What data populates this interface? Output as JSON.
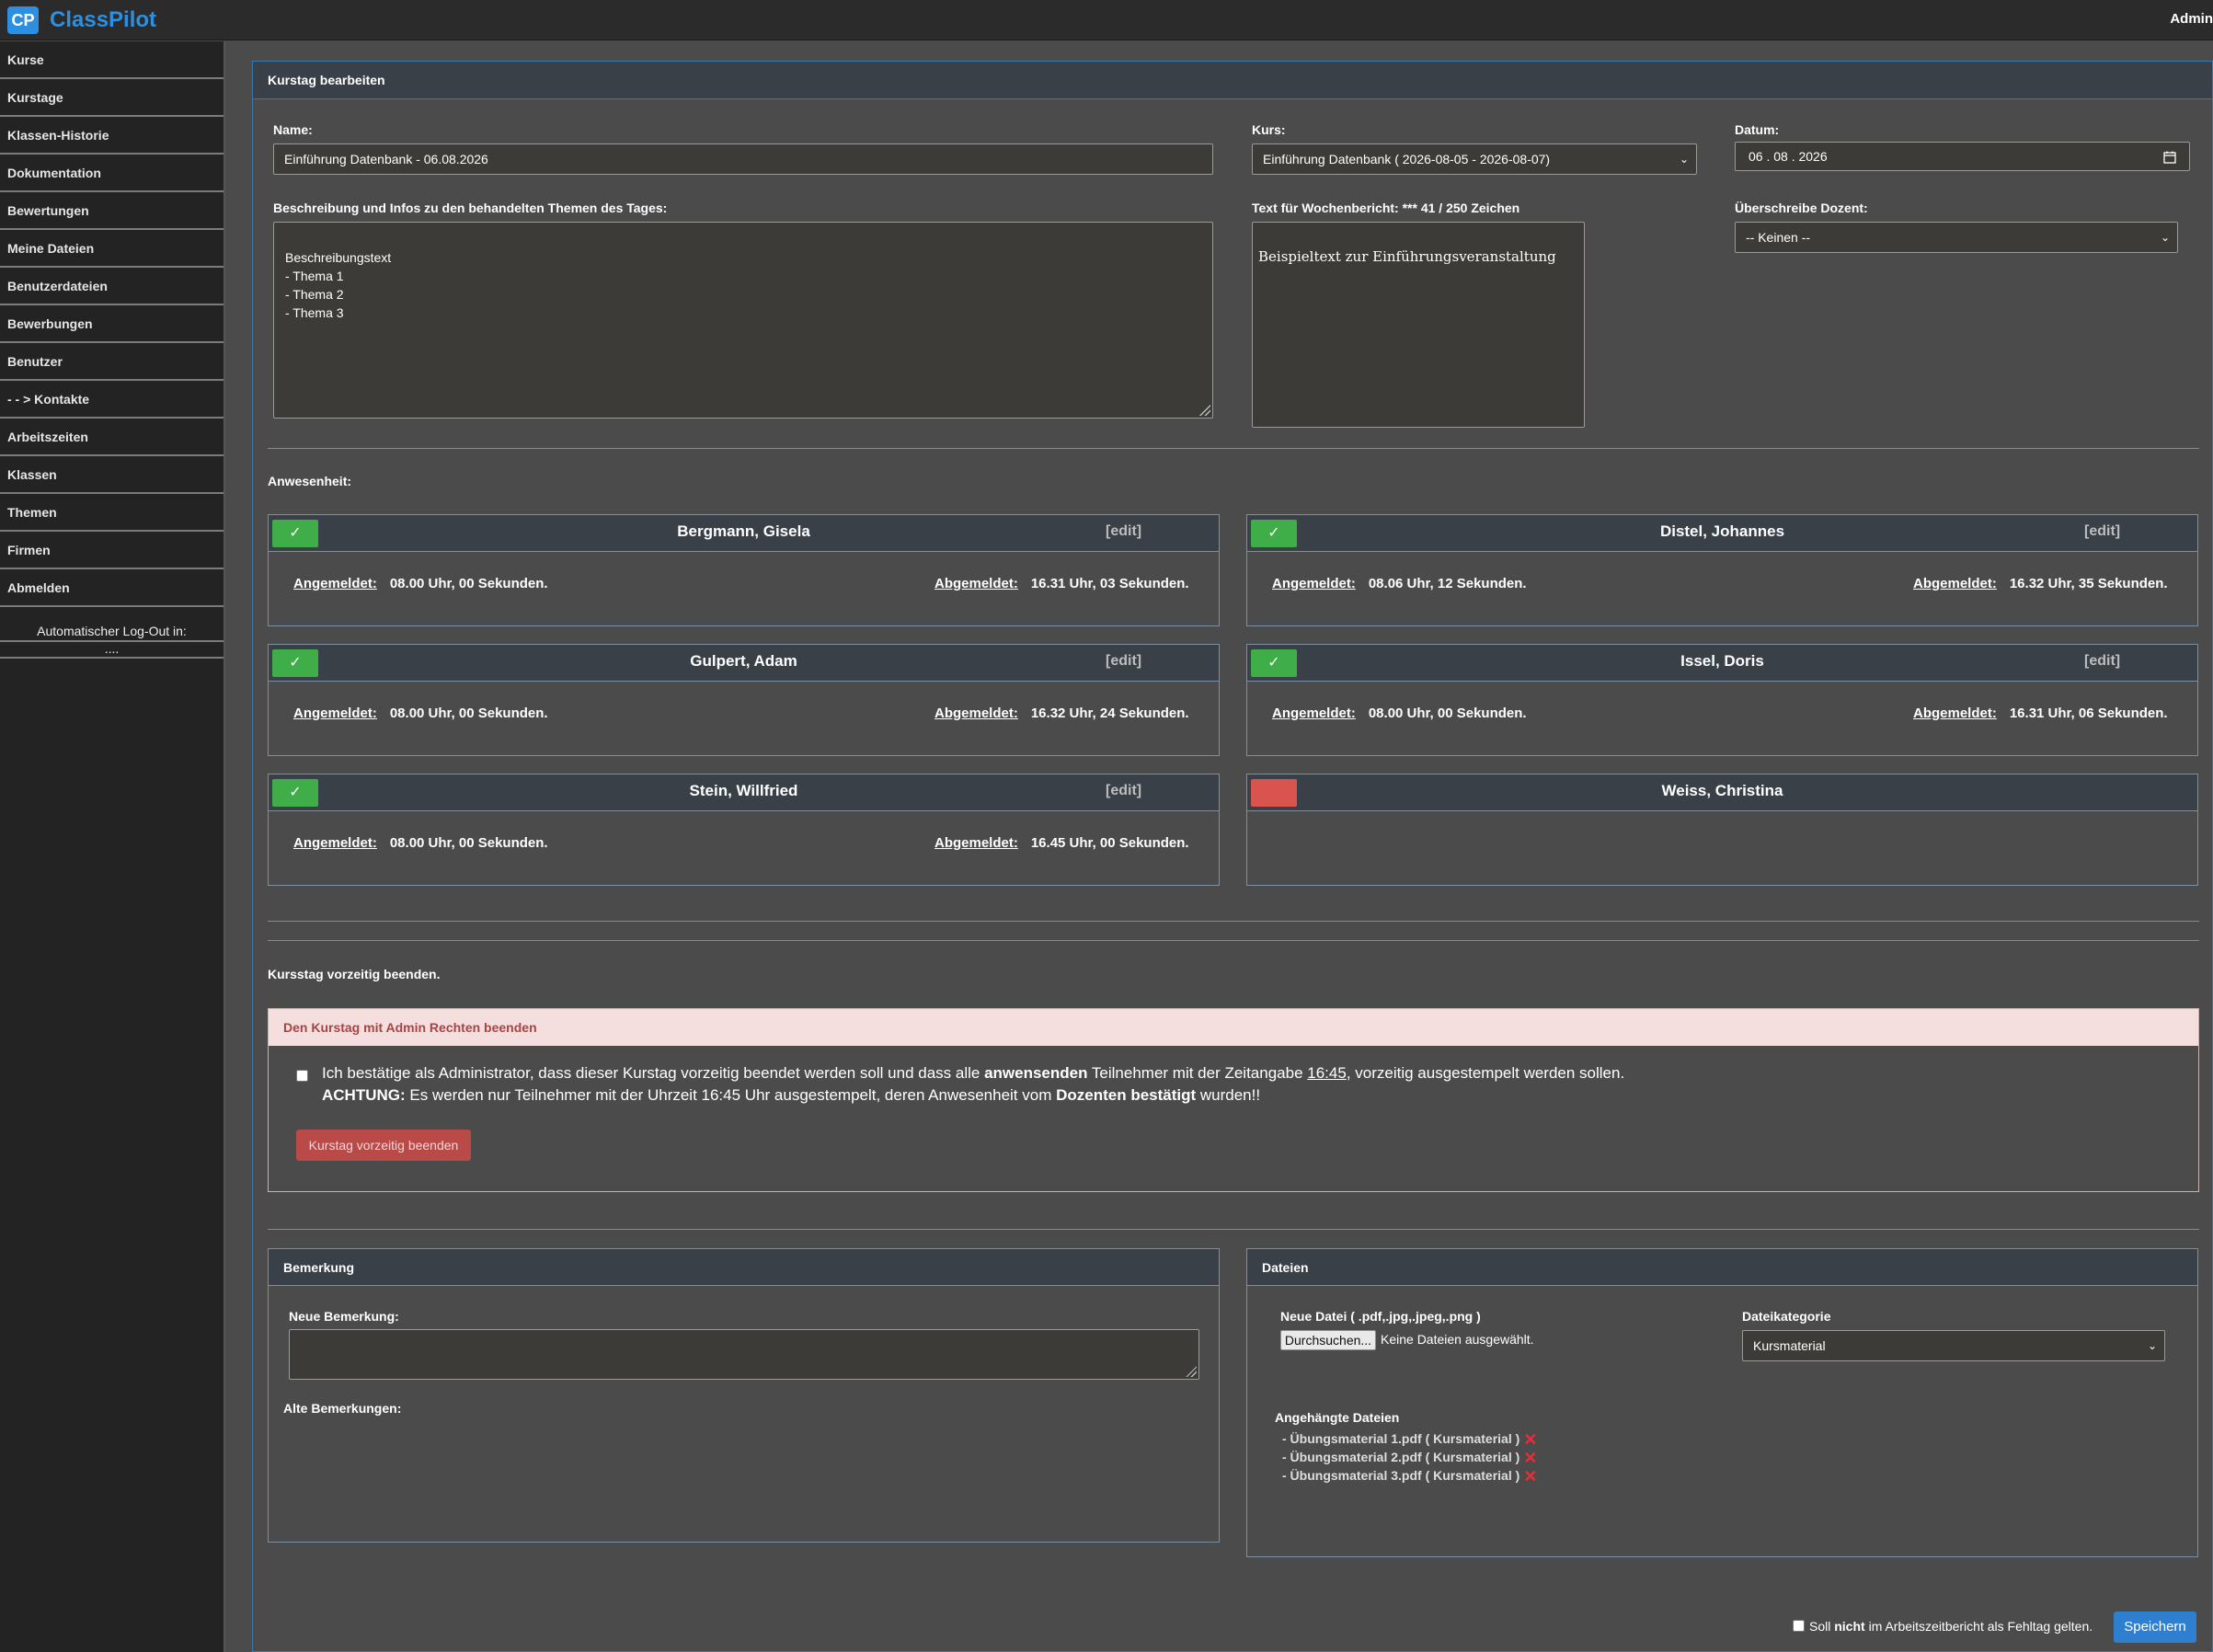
{
  "app": {
    "logo_badge": "CP",
    "name": "ClassPilot",
    "user": "Admin"
  },
  "sidebar": {
    "items": [
      {
        "label": "Kurse"
      },
      {
        "label": "Kurstage"
      },
      {
        "label": "Klassen-Historie"
      },
      {
        "label": "Dokumentation"
      },
      {
        "label": "Bewertungen"
      },
      {
        "label": "Meine Dateien"
      },
      {
        "label": "Benutzerdateien"
      },
      {
        "label": "Bewerbungen"
      },
      {
        "label": "Benutzer"
      },
      {
        "label": "- - > Kontakte"
      },
      {
        "label": "Arbeitszeiten"
      },
      {
        "label": "Klassen"
      },
      {
        "label": "Themen"
      },
      {
        "label": "Firmen"
      },
      {
        "label": "Abmelden"
      }
    ],
    "logout_label": "Automatischer Log-Out in:",
    "logout_value": "...."
  },
  "panel": {
    "title": "Kurstag bearbeiten"
  },
  "form": {
    "name_label": "Name:",
    "name_value": "Einführung Datenbank - 06.08.2026",
    "kurs_label": "Kurs:",
    "kurs_value": "Einführung Datenbank ( 2026-08-05 - 2026-08-07)",
    "datum_label": "Datum:",
    "datum_value": "06 . 08 . 2026",
    "beschreibung_label": "Beschreibung und Infos zu den behandelten Themen des Tages:",
    "beschreibung_value": "Beschreibungstext\n- Thema 1\n- Thema 2\n- Thema 3",
    "wochenbericht_label": "Text für Wochenbericht: ***   41 / 250 Zeichen",
    "wochenbericht_value": "Beispieltext zur Einführungsveranstaltung",
    "dozent_label": "Überschreibe Dozent:",
    "dozent_value": "-- Keinen --"
  },
  "attendance": {
    "label": "Anwesenheit:",
    "edit_label": "[edit]",
    "in_label": "Angemeldet:",
    "out_label": "Abgemeldet:",
    "ok_symbol": "✓",
    "people": [
      {
        "name": "Bergmann, Gisela",
        "status": "present",
        "in": "08.00 Uhr, 00 Sekunden.",
        "out": "16.31 Uhr, 03 Sekunden."
      },
      {
        "name": "Distel, Johannes",
        "status": "present",
        "in": "08.06 Uhr, 12 Sekunden.",
        "out": "16.32 Uhr, 35 Sekunden."
      },
      {
        "name": "Gulpert, Adam",
        "status": "present",
        "in": "08.00 Uhr, 00 Sekunden.",
        "out": "16.32 Uhr, 24 Sekunden."
      },
      {
        "name": "Issel, Doris",
        "status": "present",
        "in": "08.00 Uhr, 00 Sekunden.",
        "out": "16.31 Uhr, 06 Sekunden."
      },
      {
        "name": "Stein, Willfried",
        "status": "present",
        "in": "08.00 Uhr, 00 Sekunden.",
        "out": "16.45 Uhr, 00 Sekunden."
      },
      {
        "name": "Weiss, Christina",
        "status": "absent"
      }
    ]
  },
  "early_finish": {
    "section_label": "Kursstag vorzeitig beenden.",
    "box_title": "Den Kurstag mit Admin Rechten beenden",
    "text1_a": "Ich bestätige als Administrator, dass dieser Kurstag vorzeitig beendet werden soll und dass alle ",
    "text1_b": "anwensenden",
    "text1_c": " Teilnehmer mit der Zeitangabe ",
    "text1_time": "16:45",
    "text1_d": ", vorzeitig ausgestempelt werden sollen.",
    "text2_a": "ACHTUNG:",
    "text2_b": " Es werden nur Teilnehmer mit der Uhrzeit 16:45 Uhr ausgestempelt, deren Anwesenheit vom ",
    "text2_c": "Dozenten bestätigt",
    "text2_d": " wurden!!",
    "button": "Kurstag vorzeitig beenden"
  },
  "bemerkung": {
    "title": "Bemerkung",
    "new_label": "Neue Bemerkung:",
    "new_value": "",
    "old_label": "Alte Bemerkungen:"
  },
  "dateien": {
    "title": "Dateien",
    "new_file_label": "Neue Datei ( .pdf,.jpg,.jpeg,.png )",
    "browse_button": "Durchsuchen...",
    "no_file": "Keine Dateien ausgewählt.",
    "category_label": "Dateikategorie",
    "category_value": "Kursmaterial",
    "attached_label": "Angehängte Dateien",
    "files": [
      "- Übungsmaterial 1.pdf ( Kursmaterial )",
      "- Übungsmaterial 2.pdf ( Kursmaterial )",
      "- Übungsmaterial 3.pdf ( Kursmaterial )"
    ],
    "delete_symbol": "✕"
  },
  "footer": {
    "fehltag_a": "Soll ",
    "fehltag_b": "nicht",
    "fehltag_c": " im Arbeitszeitbericht als Fehltag gelten.",
    "save_button": "Speichern"
  }
}
